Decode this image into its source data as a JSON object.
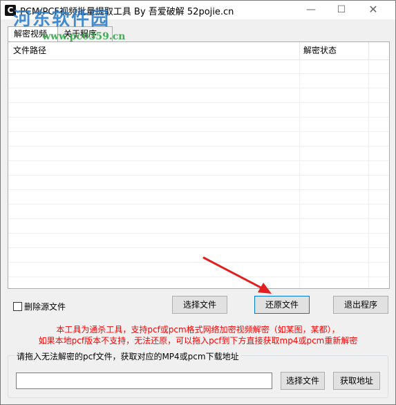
{
  "window": {
    "title": "PCM/PCF视频批量提取工具 By 吾爱破解 52pojie.cn",
    "icon_glyph": "C",
    "minimize_glyph": "—",
    "maximize_glyph": "☐",
    "close_glyph": "✕"
  },
  "watermark": {
    "text": "河东软件园",
    "url": "www.pc0359.cn"
  },
  "tabs": [
    {
      "label": "解密视频",
      "active": true
    },
    {
      "label": "关于程序",
      "active": false
    }
  ],
  "table": {
    "columns": [
      "文件路径",
      "解密状态"
    ],
    "rows": []
  },
  "checkbox": {
    "label": "删除源文件",
    "checked": false
  },
  "buttons": {
    "select_file": "选择文件",
    "restore_file": "还原文件",
    "exit": "退出程序"
  },
  "notice": {
    "line1": "本工具为通杀工具，支持pcf或pcm格式网络加密视频解密（如某图，某都），",
    "line2": "如果本地pcf版本不支持，无法还原，可以拖入pcf到下方直接获取mp4或pcm重新解密",
    "color": "#ff0000"
  },
  "download_group": {
    "label": "请拖入无法解密的pcf文件，获取对应的MP4或pcm下载地址",
    "input_value": "",
    "select_file": "选择文件",
    "get_url": "获取地址"
  },
  "colors": {
    "accent": "#0078d7",
    "arrow": "#e02020"
  }
}
